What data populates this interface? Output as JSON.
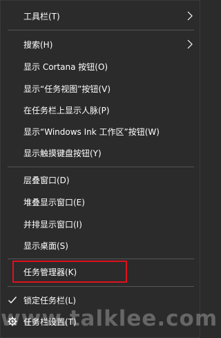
{
  "menu": {
    "items": [
      {
        "label": "工具栏(T)"
      },
      {
        "label": "搜索(H)"
      },
      {
        "label": "显示 Cortana 按钮(O)"
      },
      {
        "label": "显示“任务视图”按钮(V)"
      },
      {
        "label": "在任务栏上显示人脉(P)"
      },
      {
        "label": "显示“Windows Ink 工作区”按钮(W)"
      },
      {
        "label": "显示触摸键盘按钮(Y)"
      },
      {
        "label": "层叠窗口(D)"
      },
      {
        "label": "堆叠显示窗口(E)"
      },
      {
        "label": "并排显示窗口(I)"
      },
      {
        "label": "显示桌面(S)"
      },
      {
        "label": "任务管理器(K)"
      },
      {
        "label": "锁定任务栏(L)"
      },
      {
        "label": "任务栏设置(T)"
      }
    ]
  },
  "watermark": "www.talklee.com",
  "colors": {
    "background": "#2b2b2b",
    "highlight_border": "#e0111d",
    "separator": "#555555"
  }
}
